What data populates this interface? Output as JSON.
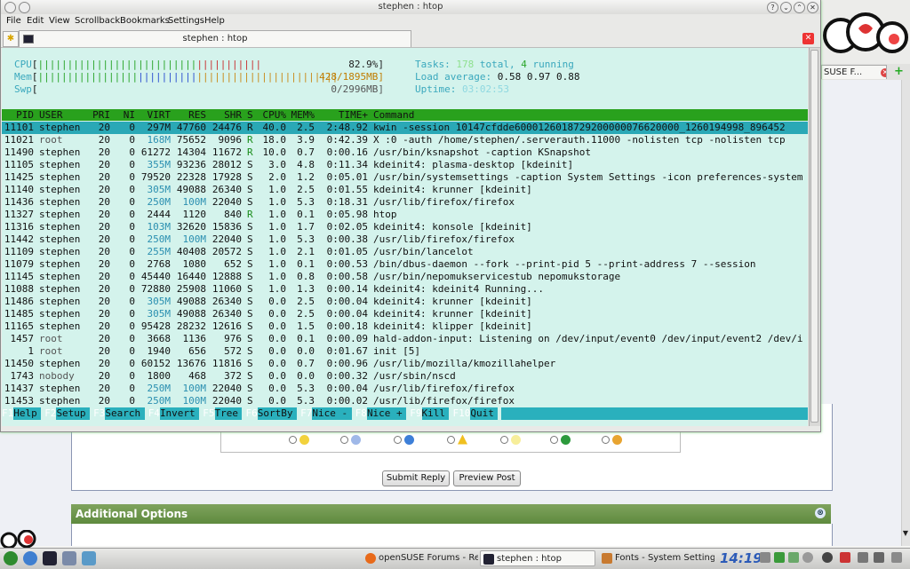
{
  "konsole": {
    "title": "stephen : htop",
    "menu": [
      "File",
      "Edit",
      "View",
      "Scrollback",
      "Bookmarks",
      "Settings",
      "Help"
    ],
    "tab_label": "stephen : htop"
  },
  "htop": {
    "cpu_label": "CPU",
    "cpu_value": "82.9%]",
    "mem_label": "Mem",
    "mem_value": "428/1895MB]",
    "swp_label": "Swp",
    "swp_value": "0/2996MB]",
    "tasks_label": "Tasks:",
    "tasks_total": "178",
    "tasks_total_word": "total,",
    "tasks_running": "4",
    "tasks_running_word": "running",
    "load_label": "Load average:",
    "load_1": "0.58",
    "load_5": "0.97",
    "load_15": "0.88",
    "uptime_label": "Uptime:",
    "uptime_value": "03:02:53",
    "columns": [
      "PID",
      "USER",
      "PRI",
      "NI",
      "VIRT",
      "RES",
      "SHR",
      "S",
      "CPU%",
      "MEM%",
      "TIME+",
      "Command"
    ],
    "rows": [
      [
        "11101",
        "stephen",
        "20",
        "0",
        "297M",
        "47760",
        "24476",
        "R",
        "40.0",
        "2.5",
        "2:48.92",
        "kwin -session 10147cfdde6000126018729200000076620000_1260194998_896452"
      ],
      [
        "11021",
        "root",
        "20",
        "0",
        "168M",
        "75652",
        "9096",
        "R",
        "18.0",
        "3.9",
        "0:42.39",
        "X :0 -auth /home/stephen/.serverauth.11000 -nolisten tcp -nolisten tcp"
      ],
      [
        "11490",
        "stephen",
        "20",
        "0",
        "61272",
        "14304",
        "11672",
        "R",
        "10.0",
        "0.7",
        "0:00.16",
        "/usr/bin/ksnapshot -caption KSnapshot"
      ],
      [
        "11105",
        "stephen",
        "20",
        "0",
        "355M",
        "93236",
        "28012",
        "S",
        "3.0",
        "4.8",
        "0:11.34",
        "kdeinit4: plasma-desktop [kdeinit]"
      ],
      [
        "11425",
        "stephen",
        "20",
        "0",
        "79520",
        "22328",
        "17928",
        "S",
        "2.0",
        "1.2",
        "0:05.01",
        "/usr/bin/systemsettings -caption System Settings -icon preferences-system"
      ],
      [
        "11140",
        "stephen",
        "20",
        "0",
        "305M",
        "49088",
        "26340",
        "S",
        "1.0",
        "2.5",
        "0:01.55",
        "kdeinit4: krunner [kdeinit]"
      ],
      [
        "11436",
        "stephen",
        "20",
        "0",
        "250M",
        "100M",
        "22040",
        "S",
        "1.0",
        "5.3",
        "0:18.31",
        "/usr/lib/firefox/firefox"
      ],
      [
        "11327",
        "stephen",
        "20",
        "0",
        "2444",
        "1120",
        "840",
        "R",
        "1.0",
        "0.1",
        "0:05.98",
        "htop"
      ],
      [
        "11316",
        "stephen",
        "20",
        "0",
        "103M",
        "32620",
        "15836",
        "S",
        "1.0",
        "1.7",
        "0:02.05",
        "kdeinit4: konsole [kdeinit]"
      ],
      [
        "11442",
        "stephen",
        "20",
        "0",
        "250M",
        "100M",
        "22040",
        "S",
        "1.0",
        "5.3",
        "0:00.38",
        "/usr/lib/firefox/firefox"
      ],
      [
        "11109",
        "stephen",
        "20",
        "0",
        "255M",
        "40408",
        "20572",
        "S",
        "1.0",
        "2.1",
        "0:01.05",
        "/usr/bin/lancelot"
      ],
      [
        "11079",
        "stephen",
        "20",
        "0",
        "2768",
        "1080",
        "652",
        "S",
        "1.0",
        "0.1",
        "0:00.53",
        "/bin/dbus-daemon --fork --print-pid 5 --print-address 7 --session"
      ],
      [
        "11145",
        "stephen",
        "20",
        "0",
        "45440",
        "16440",
        "12888",
        "S",
        "1.0",
        "0.8",
        "0:00.58",
        "/usr/bin/nepomukservicestub nepomukstorage"
      ],
      [
        "11088",
        "stephen",
        "20",
        "0",
        "72880",
        "25908",
        "11060",
        "S",
        "1.0",
        "1.3",
        "0:00.14",
        "kdeinit4: kdeinit4 Running..."
      ],
      [
        "11486",
        "stephen",
        "20",
        "0",
        "305M",
        "49088",
        "26340",
        "S",
        "0.0",
        "2.5",
        "0:00.04",
        "kdeinit4: krunner [kdeinit]"
      ],
      [
        "11485",
        "stephen",
        "20",
        "0",
        "305M",
        "49088",
        "26340",
        "S",
        "0.0",
        "2.5",
        "0:00.04",
        "kdeinit4: krunner [kdeinit]"
      ],
      [
        "11165",
        "stephen",
        "20",
        "0",
        "95428",
        "28232",
        "12616",
        "S",
        "0.0",
        "1.5",
        "0:00.18",
        "kdeinit4: klipper [kdeinit]"
      ],
      [
        "1457",
        "root",
        "20",
        "0",
        "3668",
        "1136",
        "976",
        "S",
        "0.0",
        "0.1",
        "0:00.09",
        "hald-addon-input: Listening on /dev/input/event0 /dev/input/event2 /dev/i"
      ],
      [
        "1",
        "root",
        "20",
        "0",
        "1940",
        "656",
        "572",
        "S",
        "0.0",
        "0.0",
        "0:01.67",
        "init [5]"
      ],
      [
        "11450",
        "stephen",
        "20",
        "0",
        "60152",
        "13676",
        "11816",
        "S",
        "0.0",
        "0.7",
        "0:00.96",
        "/usr/lib/mozilla/kmozillahelper"
      ],
      [
        "1743",
        "nobody",
        "20",
        "0",
        "1800",
        "468",
        "372",
        "S",
        "0.0",
        "0.0",
        "0:00.32",
        "/usr/sbin/nscd"
      ],
      [
        "11437",
        "stephen",
        "20",
        "0",
        "250M",
        "100M",
        "22040",
        "S",
        "0.0",
        "5.3",
        "0:00.04",
        "/usr/lib/firefox/firefox"
      ],
      [
        "11453",
        "stephen",
        "20",
        "0",
        "250M",
        "100M",
        "22040",
        "S",
        "0.0",
        "5.3",
        "0:00.02",
        "/usr/lib/firefox/firefox"
      ]
    ],
    "fkeys": [
      {
        "key": "F1",
        "label": "Help"
      },
      {
        "key": "F2",
        "label": "Setup"
      },
      {
        "key": "F3",
        "label": "Search"
      },
      {
        "key": "F4",
        "label": "Invert"
      },
      {
        "key": "F5",
        "label": "Tree"
      },
      {
        "key": "F6",
        "label": "SortBy"
      },
      {
        "key": "F7",
        "label": "Nice -"
      },
      {
        "key": "F8",
        "label": "Nice +"
      },
      {
        "key": "F9",
        "label": "Kill"
      },
      {
        "key": "F10",
        "label": "Quit"
      }
    ]
  },
  "browser": {
    "tab_label": "SUSE F...",
    "submit_label": "Submit Reply",
    "preview_label": "Preview Post",
    "additional_options": "Additional Options"
  },
  "taskbar": {
    "tasks": [
      "openSUSE Forums - Repl...",
      "stephen : htop",
      "Fonts - System Settings"
    ],
    "clock": "14:19"
  },
  "colors": {
    "terminal_bg": "#d4f3ec",
    "header_bar": "#29a11d",
    "selected_row": "#2aa8b6",
    "forum_green": "#6a9448"
  }
}
